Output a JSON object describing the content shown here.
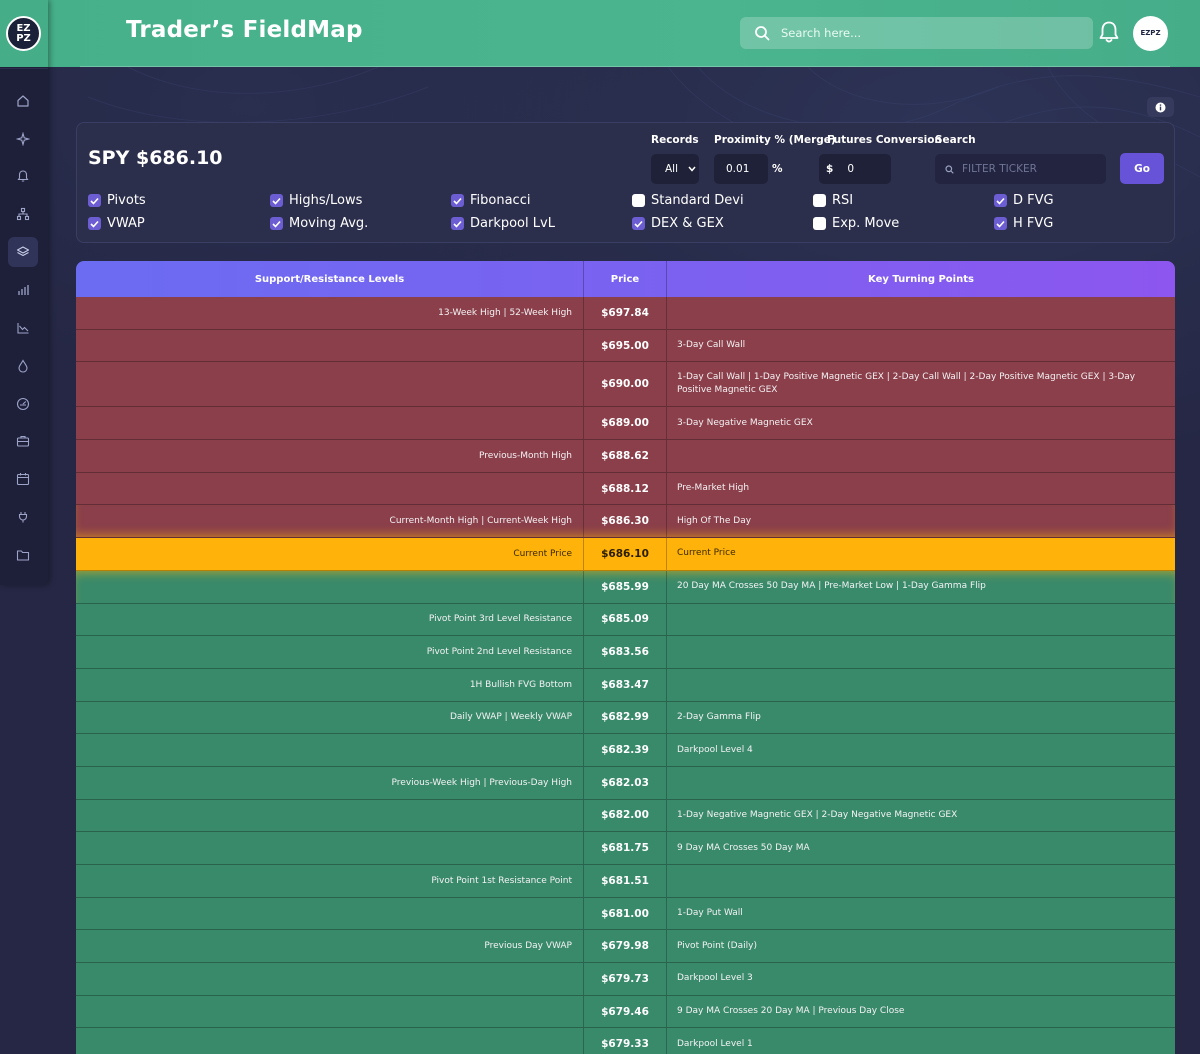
{
  "header": {
    "title": "Trader’s FieldMap",
    "search_placeholder": "Search here...",
    "avatar_text": "EZPZ",
    "logo_text_top": "EZ",
    "logo_text_bottom": "PZ"
  },
  "panel": {
    "ticker_price": "SPY $686.10",
    "records_label": "Records",
    "records_value": "All",
    "proximity_label": "Proximity % (Merge)",
    "proximity_value": "0.01",
    "proximity_unit": "%",
    "futures_label": "Futures Conversion",
    "futures_prefix": "$",
    "futures_value": "0",
    "search_label": "Search",
    "filter_placeholder": "FILTER TICKER",
    "go_label": "Go",
    "checkboxes": [
      {
        "label": "Pivots",
        "checked": true
      },
      {
        "label": "Highs/Lows",
        "checked": true
      },
      {
        "label": "Fibonacci",
        "checked": true
      },
      {
        "label": "Standard Devi",
        "checked": false
      },
      {
        "label": "RSI",
        "checked": false
      },
      {
        "label": "D FVG",
        "checked": true
      },
      {
        "label": "VWAP",
        "checked": true
      },
      {
        "label": "Moving Avg.",
        "checked": true
      },
      {
        "label": "Darkpool LvL",
        "checked": true
      },
      {
        "label": "DEX & GEX",
        "checked": true
      },
      {
        "label": "Exp. Move",
        "checked": false
      },
      {
        "label": "H FVG",
        "checked": true
      }
    ]
  },
  "table": {
    "headers": [
      "Support/Resistance Levels",
      "Price",
      "Key Turning Points"
    ],
    "rows": [
      {
        "type": "res",
        "level": "13-Week High | 52-Week High",
        "price": "$697.84",
        "turning": ""
      },
      {
        "type": "res",
        "level": "",
        "price": "$695.00",
        "turning": "3-Day Call Wall"
      },
      {
        "type": "res",
        "level": "",
        "price": "$690.00",
        "turning": "1-Day Call Wall | 1-Day Positive Magnetic GEX | 2-Day Call Wall | 2-Day Positive Magnetic GEX | 3-Day Positive Magnetic GEX"
      },
      {
        "type": "res",
        "level": "",
        "price": "$689.00",
        "turning": "3-Day Negative Magnetic GEX"
      },
      {
        "type": "res",
        "level": "Previous-Month High",
        "price": "$688.62",
        "turning": ""
      },
      {
        "type": "res",
        "level": "",
        "price": "$688.12",
        "turning": "Pre-Market High"
      },
      {
        "type": "res",
        "level": "Current-Month High | Current-Week High",
        "price": "$686.30",
        "turning": "High Of The Day"
      },
      {
        "type": "cur",
        "level": "Current Price",
        "price": "$686.10",
        "turning": "Current Price"
      },
      {
        "type": "sup",
        "level": "",
        "price": "$685.99",
        "turning": "20 Day MA Crosses 50 Day MA | Pre-Market Low | 1-Day Gamma Flip"
      },
      {
        "type": "sup",
        "level": "Pivot Point 3rd Level Resistance",
        "price": "$685.09",
        "turning": ""
      },
      {
        "type": "sup",
        "level": "Pivot Point 2nd Level Resistance",
        "price": "$683.56",
        "turning": ""
      },
      {
        "type": "sup",
        "level": "1H Bullish FVG Bottom",
        "price": "$683.47",
        "turning": ""
      },
      {
        "type": "sup",
        "level": "Daily VWAP | Weekly VWAP",
        "price": "$682.99",
        "turning": "2-Day Gamma Flip"
      },
      {
        "type": "sup",
        "level": "",
        "price": "$682.39",
        "turning": "Darkpool Level 4"
      },
      {
        "type": "sup",
        "level": "Previous-Week High | Previous-Day High",
        "price": "$682.03",
        "turning": ""
      },
      {
        "type": "sup",
        "level": "",
        "price": "$682.00",
        "turning": "1-Day Negative Magnetic GEX | 2-Day Negative Magnetic GEX"
      },
      {
        "type": "sup",
        "level": "",
        "price": "$681.75",
        "turning": "9 Day MA Crosses 50 Day MA"
      },
      {
        "type": "sup",
        "level": "Pivot Point 1st Resistance Point",
        "price": "$681.51",
        "turning": ""
      },
      {
        "type": "sup",
        "level": "",
        "price": "$681.00",
        "turning": "1-Day Put Wall"
      },
      {
        "type": "sup",
        "level": "Previous Day VWAP",
        "price": "$679.98",
        "turning": "Pivot Point (Daily)"
      },
      {
        "type": "sup",
        "level": "",
        "price": "$679.73",
        "turning": "Darkpool Level 3"
      },
      {
        "type": "sup",
        "level": "",
        "price": "$679.46",
        "turning": "9 Day MA Crosses 20 Day MA | Previous Day Close"
      },
      {
        "type": "sup",
        "level": "",
        "price": "$679.33",
        "turning": "Darkpool Level 1"
      }
    ]
  },
  "sidebar": {
    "icons": [
      "home-icon",
      "sparkle-icon",
      "bell-icon",
      "network-icon",
      "layers-icon",
      "bar-chart-icon",
      "line-chart-icon",
      "drop-icon",
      "gauge-icon",
      "briefcase-icon",
      "calendar-icon",
      "plug-icon",
      "folder-icon"
    ],
    "active_index": 4
  },
  "colors": {
    "header": "#4ab58f",
    "resistance_row": "#8a3f4a",
    "support_row": "#398a6b",
    "current_row": "#ffb20a",
    "accent": "#6c5dd3"
  }
}
